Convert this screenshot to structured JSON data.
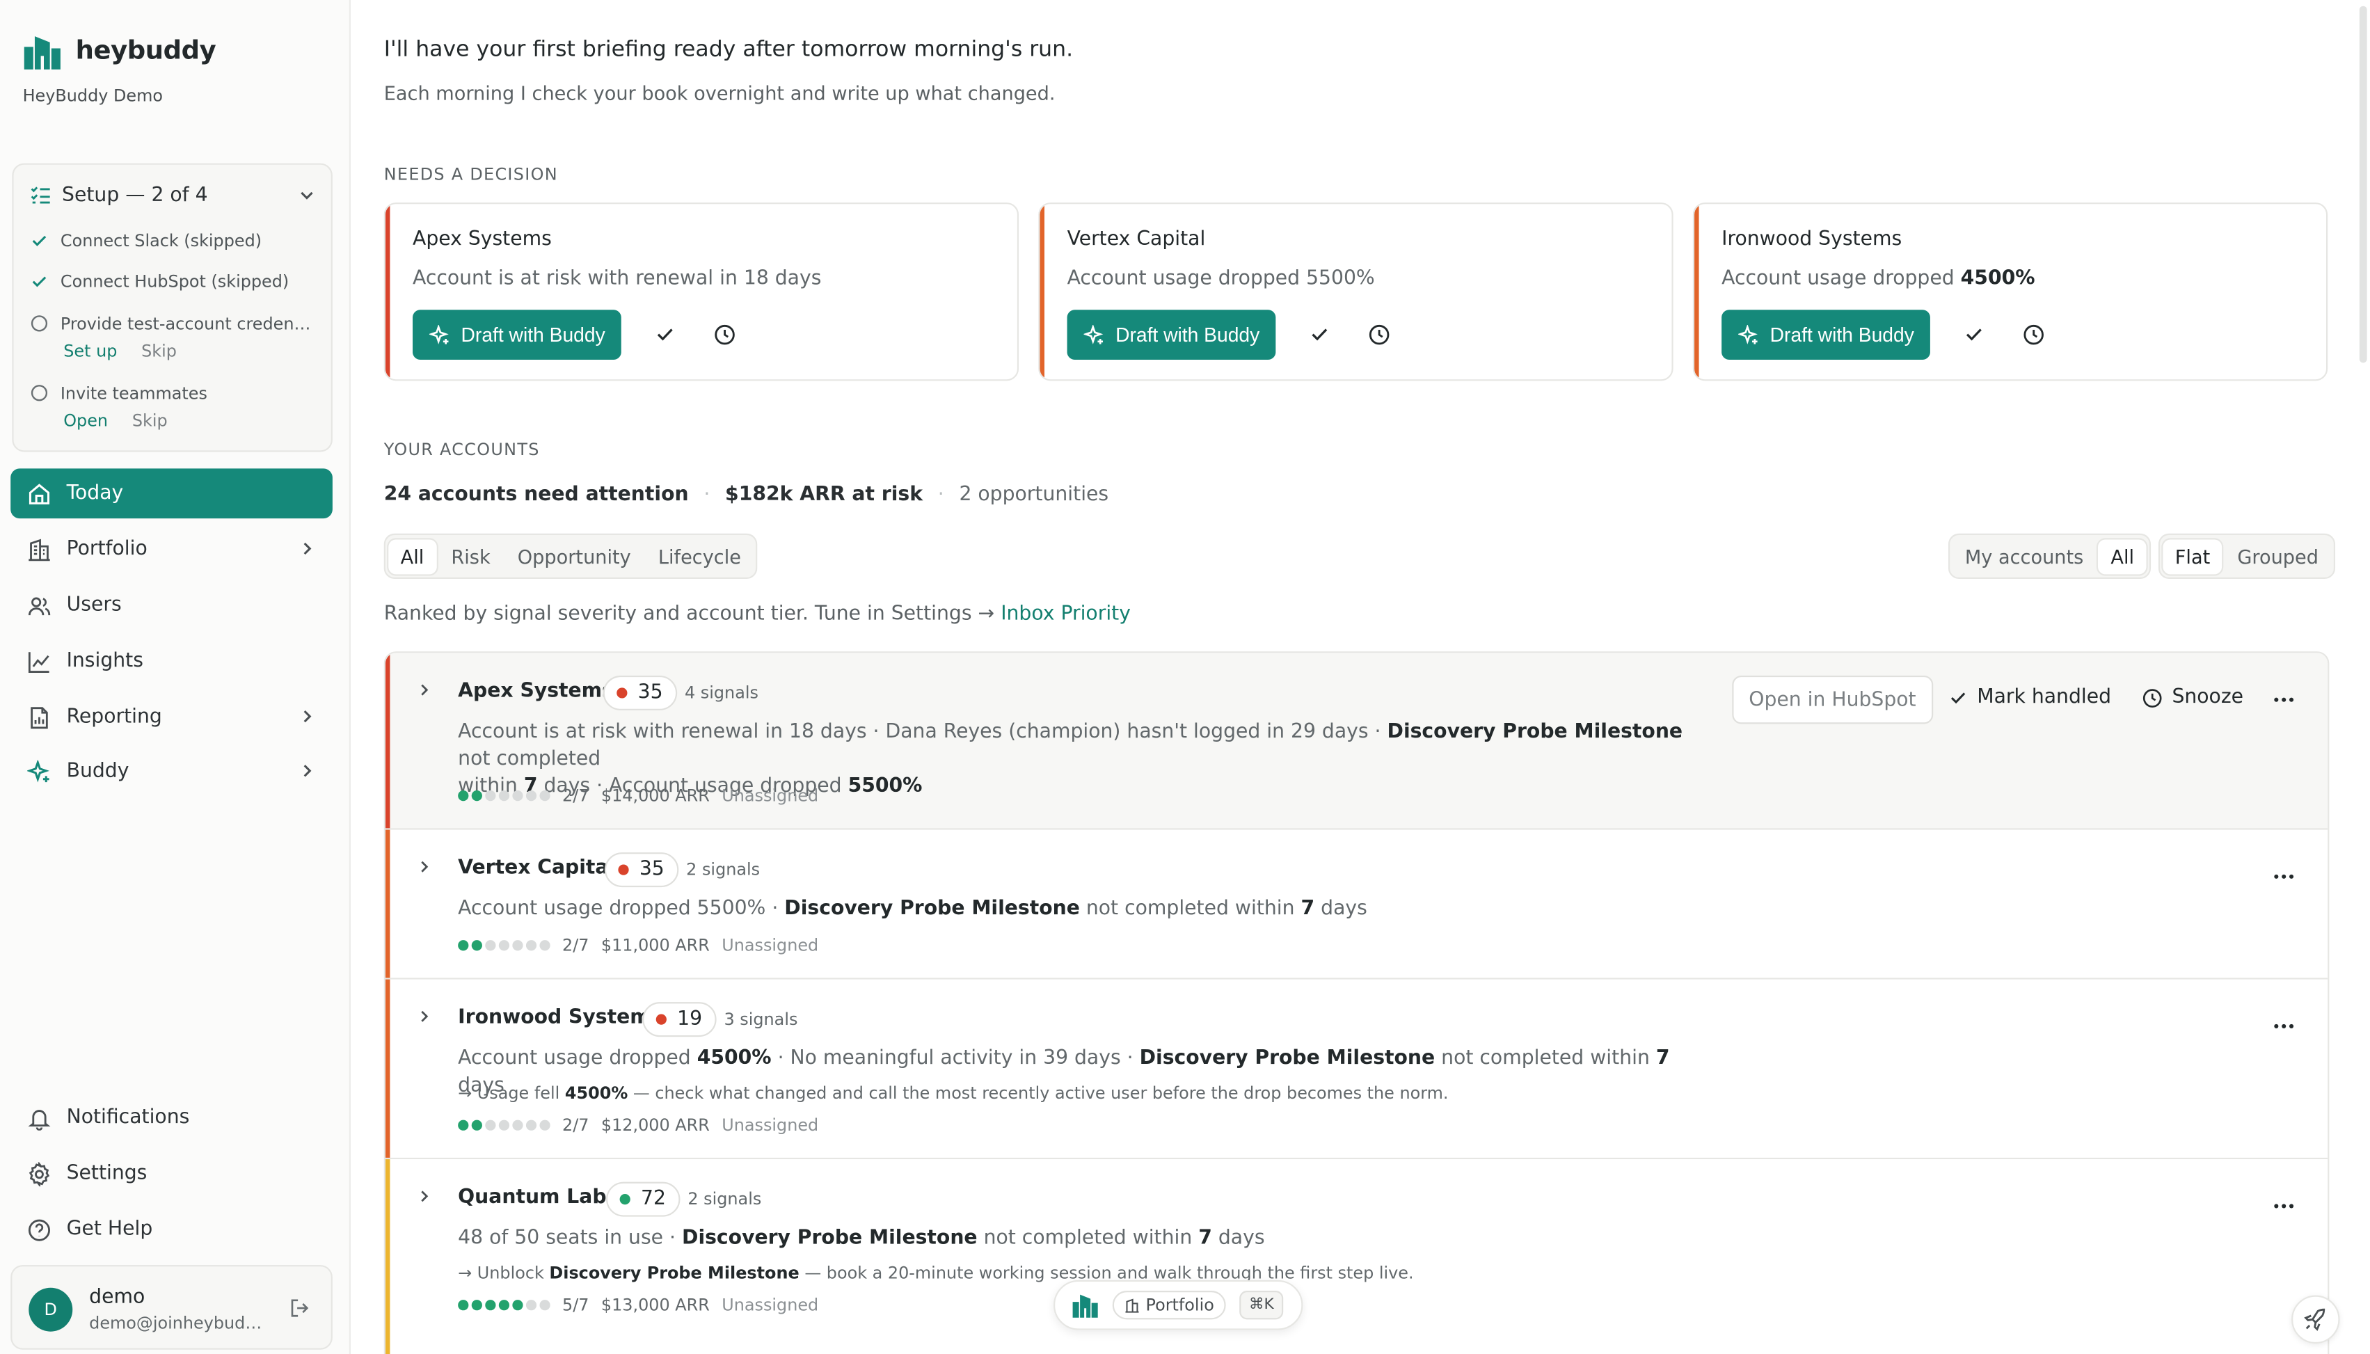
{
  "brand": {
    "name": "heybuddy",
    "org": "HeyBuddy Demo"
  },
  "setup": {
    "title": "Setup — 2 of 4",
    "items": [
      {
        "label": "Connect Slack (skipped)",
        "done": true
      },
      {
        "label": "Connect HubSpot (skipped)",
        "done": true
      },
      {
        "label": "Provide test-account credentials",
        "done": false,
        "primary": "Set up",
        "secondary": "Skip"
      },
      {
        "label": "Invite teammates",
        "done": false,
        "primary": "Open",
        "secondary": "Skip"
      }
    ]
  },
  "nav": {
    "items": [
      {
        "label": "Today",
        "icon": "home-icon",
        "active": true
      },
      {
        "label": "Portfolio",
        "icon": "building-icon",
        "chevron": true
      },
      {
        "label": "Users",
        "icon": "users-icon"
      },
      {
        "label": "Insights",
        "icon": "chart-line-icon"
      },
      {
        "label": "Reporting",
        "icon": "report-icon",
        "chevron": true
      },
      {
        "label": "Buddy",
        "icon": "sparkle-icon",
        "chevron": true
      }
    ],
    "bottom": [
      {
        "label": "Notifications",
        "icon": "bell-icon"
      },
      {
        "label": "Settings",
        "icon": "gear-icon"
      },
      {
        "label": "Get Help",
        "icon": "help-icon"
      }
    ]
  },
  "user": {
    "initial": "D",
    "name": "demo",
    "email": "demo@joinheybuddy.com"
  },
  "hero": {
    "title": "I'll have your first briefing ready after tomorrow morning's run.",
    "subtitle": "Each morning I check your book overnight and write up what changed."
  },
  "decisions": {
    "label": "NEEDS A DECISION",
    "draft_label": "Draft with Buddy",
    "cards": [
      {
        "name": "Apex Systems",
        "desc_pre": "Account is at risk with renewal in 18 days",
        "desc_bold": "",
        "color": "#d9432b"
      },
      {
        "name": "Vertex Capital",
        "desc_pre": "Account usage dropped 5500%",
        "desc_bold": "",
        "color": "#e2642a"
      },
      {
        "name": "Ironwood Systems",
        "desc_pre": "Account usage dropped ",
        "desc_bold": "4500%",
        "color": "#e2642a"
      }
    ]
  },
  "accounts": {
    "label": "YOUR ACCOUNTS",
    "summary": {
      "attention": "24 accounts need attention",
      "arr": "$182k ARR at risk",
      "opps": "2 opportunities"
    },
    "filters": [
      "All",
      "Risk",
      "Opportunity",
      "Lifecycle"
    ],
    "scope": [
      "My accounts",
      "All"
    ],
    "view": [
      "Flat",
      "Grouped"
    ],
    "ranked_text": "Ranked by signal severity and account tier. Tune in Settings →",
    "ranked_link": "Inbox Priority",
    "open_hubspot": "Open in HubSpot",
    "mark_handled": "Mark handled",
    "snooze": "Snooze"
  },
  "rows": [
    {
      "name": "Apex Systems",
      "score": "35",
      "score_color": "#d9432b",
      "signals": "4 signals",
      "bar": "#d9432b",
      "line1": [
        "Account is at risk with renewal in 18 days · Dana Reyes (champion) hasn't logged in 29 days · ",
        "Discovery Probe Milestone",
        " not completed"
      ],
      "line2": [
        "within ",
        "7",
        " days · Account usage dropped ",
        "5500%"
      ],
      "progress": 2,
      "stage": "2/7",
      "arr": "$14,000 ARR",
      "owner": "Unassigned"
    },
    {
      "name": "Vertex Capital",
      "score": "35",
      "score_color": "#d9432b",
      "signals": "2 signals",
      "bar": "#e2642a",
      "line1": [
        "Account usage dropped 5500% · ",
        "Discovery Probe Milestone",
        " not completed within ",
        "7",
        " days"
      ],
      "progress": 2,
      "stage": "2/7",
      "arr": "$11,000 ARR",
      "owner": "Unassigned"
    },
    {
      "name": "Ironwood Systems",
      "score": "19",
      "score_color": "#d9432b",
      "signals": "3 signals",
      "bar": "#e2642a",
      "line1": [
        "Account usage dropped ",
        "4500%",
        " · No meaningful activity in 39 days · ",
        "Discovery Probe Milestone",
        " not completed within ",
        "7",
        " days"
      ],
      "hint": [
        "→ Usage fell ",
        "4500%",
        " — check what changed and call the most recently active user before the drop becomes the norm."
      ],
      "progress": 2,
      "stage": "2/7",
      "arr": "$12,000 ARR",
      "owner": "Unassigned"
    },
    {
      "name": "Quantum Labs",
      "score": "72",
      "score_color": "#23a26d",
      "signals": "2 signals",
      "bar": "#ecb52f",
      "line1": [
        "48 of 50 seats in use · ",
        "Discovery Probe Milestone",
        " not completed within ",
        "7",
        " days"
      ],
      "hint": [
        "→ Unblock ",
        "Discovery Probe Milestone",
        " — book a 20-minute working session and walk through the first step live."
      ],
      "progress": 5,
      "stage": "5/7",
      "arr": "$13,000 ARR",
      "owner": "Unassigned"
    }
  ],
  "command_pill": {
    "chip": "Portfolio",
    "shortcut": "⌘K"
  }
}
